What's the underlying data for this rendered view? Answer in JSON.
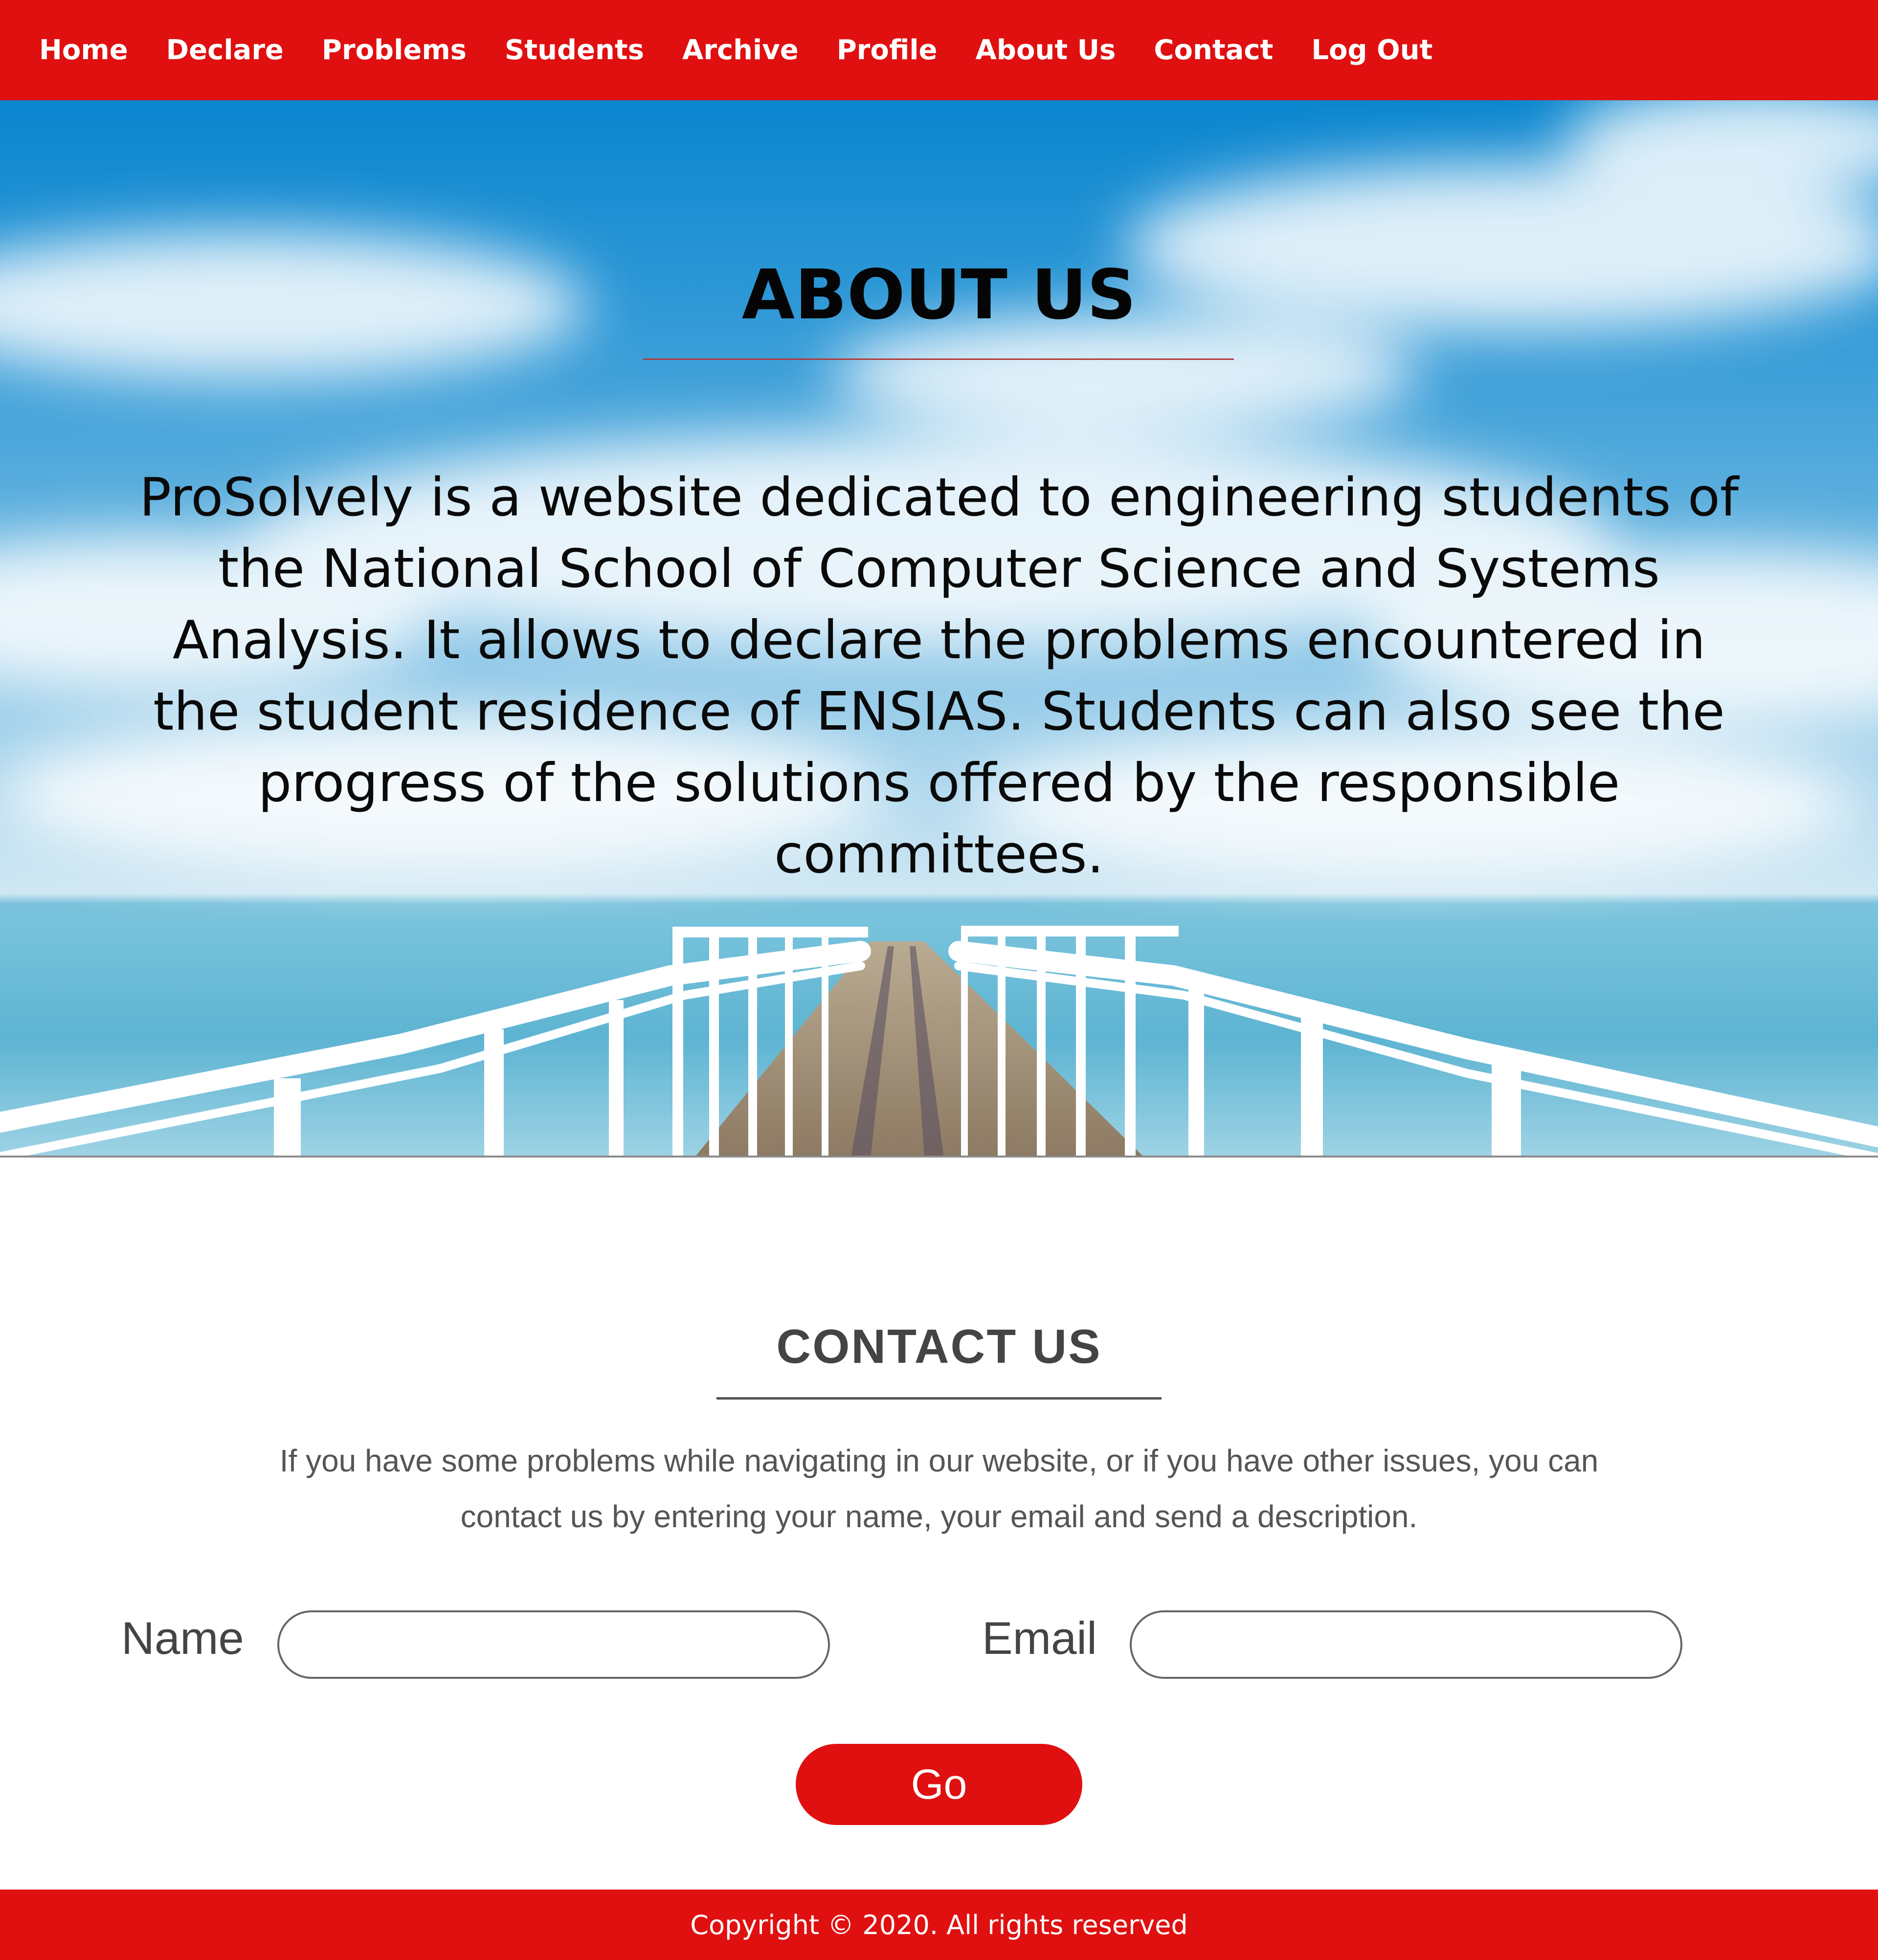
{
  "nav": {
    "items": [
      {
        "label": "Home"
      },
      {
        "label": "Declare"
      },
      {
        "label": "Problems"
      },
      {
        "label": "Students"
      },
      {
        "label": "Archive"
      },
      {
        "label": "Profile"
      },
      {
        "label": "About Us"
      },
      {
        "label": "Contact"
      },
      {
        "label": "Log Out"
      }
    ]
  },
  "about": {
    "title": "ABOUT US",
    "text": "ProSolvely is a website dedicated to engineering students of the National School of Computer Science and Systems Analysis. It allows to declare the problems encountered in the student residence of ENSIAS. Students can also see the progress of the solutions offered by the responsible committees."
  },
  "contact": {
    "title": "CONTACT US",
    "description": "If you have some problems while navigating in our website, or if you have other issues, you can contact us by entering your name, your email and send a description.",
    "name_label": "Name",
    "name_value": "",
    "email_label": "Email",
    "email_value": "",
    "submit_label": "Go"
  },
  "footer": {
    "copyright": "Copyright © 2020. All rights reserved"
  },
  "colors": {
    "brand_red": "#e01010",
    "text_dark": "#444444",
    "sky_blue": "#0b86cf"
  }
}
